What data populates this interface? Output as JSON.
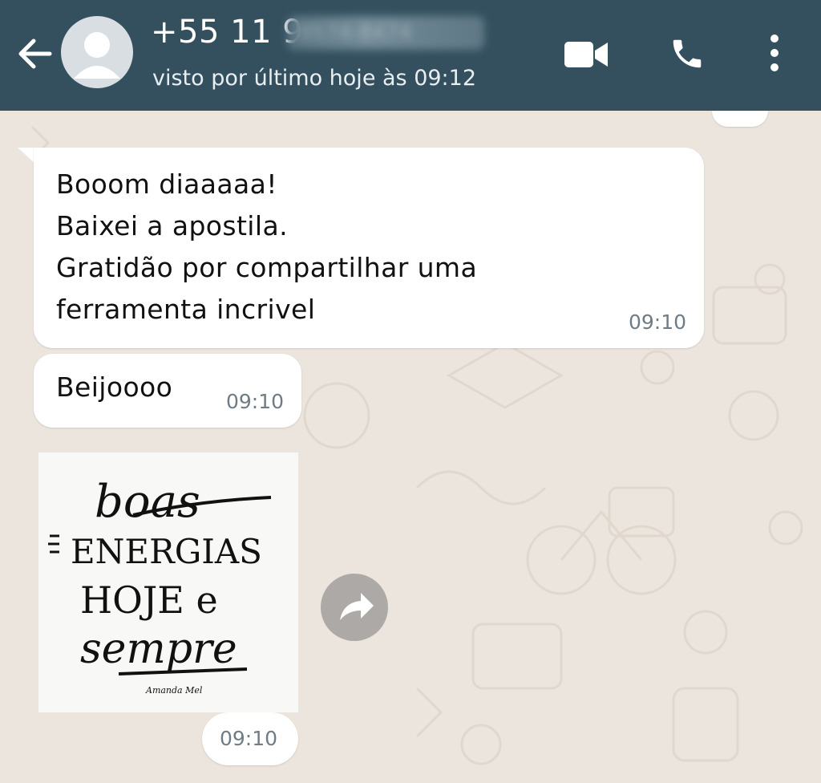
{
  "header": {
    "contact_number": "+55 11 9",
    "contact_number_hidden": "9574-8474",
    "last_seen": "visto por último hoje às 09:12",
    "icons": [
      "back-arrow-icon",
      "avatar-icon",
      "video-call-icon",
      "phone-call-icon",
      "more-options-icon"
    ],
    "bg_color": "#34505F"
  },
  "messages": [
    {
      "lines": [
        "Booom diaaaaa!",
        "Baixei a apostila.",
        "Gratidão por compartilhar uma",
        "ferramenta incrivel"
      ],
      "time": "09:10"
    },
    {
      "text": "Beijoooo",
      "time": "09:10"
    },
    {
      "type": "image",
      "image_text": [
        "boas",
        "ENERGIAS",
        "HOJE e",
        "sempre"
      ],
      "signature": "Amanda Mel",
      "time": "09:10",
      "forward_icon": "forward-icon"
    }
  ],
  "colors": {
    "chat_bg": "#ECE5DD",
    "bubble": "#FFFFFF",
    "timestamp": "#6F7C85"
  }
}
